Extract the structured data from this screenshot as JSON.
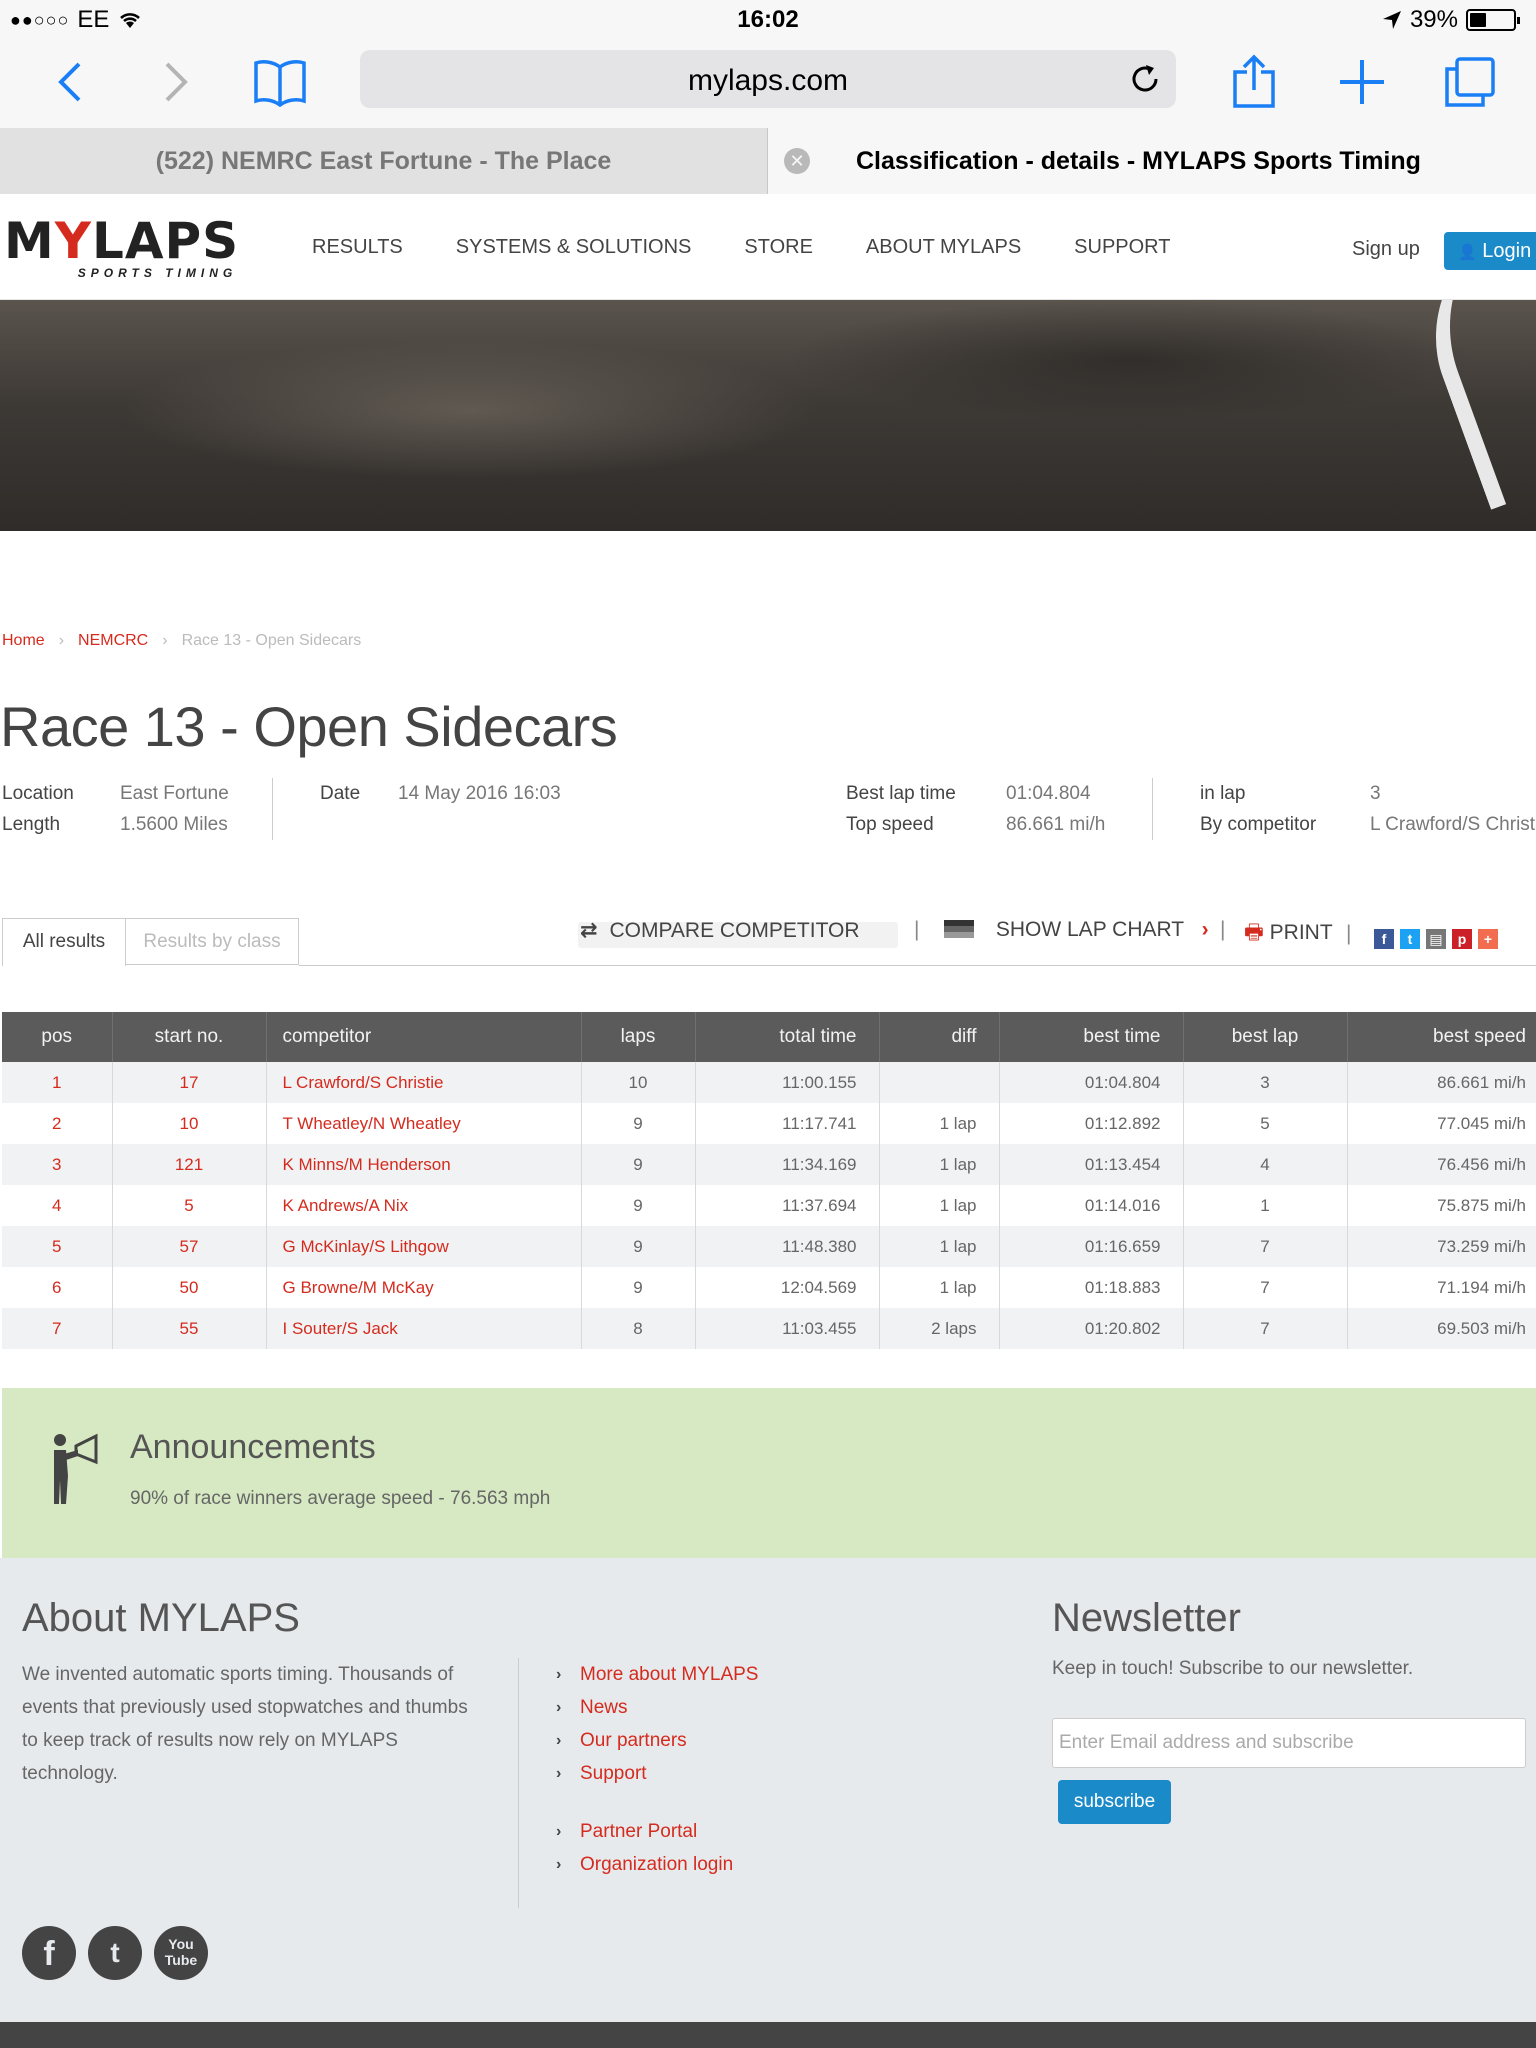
{
  "status_bar": {
    "carrier": "EE",
    "time": "16:02",
    "battery": "39%",
    "battery_level": 0.39
  },
  "browser": {
    "url": "mylaps.com",
    "tabs": [
      {
        "title": "(522) NEMRC East Fortune - The Place"
      },
      {
        "title": "Classification - details - MYLAPS Sports Timing"
      }
    ]
  },
  "header": {
    "logo_word_a": "M",
    "logo_word_b": "Y",
    "logo_word_c": "LAPS",
    "logo_sub": "SPORTS TIMING",
    "nav": [
      "RESULTS",
      "SYSTEMS & SOLUTIONS",
      "STORE",
      "ABOUT MYLAPS",
      "SUPPORT"
    ],
    "signup": "Sign up",
    "login": "Login"
  },
  "breadcrumb": {
    "home": "Home",
    "org": "NEMCRC",
    "current": "Race 13 - Open Sidecars"
  },
  "race": {
    "title": "Race 13 - Open Sidecars",
    "location_label": "Location",
    "location": "East Fortune",
    "length_label": "Length",
    "length": "1.5600 Miles",
    "date_label": "Date",
    "date": "14 May 2016 16:03",
    "best_lap_label": "Best lap time",
    "best_lap": "01:04.804",
    "top_speed_label": "Top speed",
    "top_speed": "86.661 mi/h",
    "in_lap_label": "in lap",
    "in_lap": "3",
    "by_label": "By competitor",
    "by": "L Crawford/S Christi"
  },
  "result_tabs": {
    "all": "All results",
    "by_class": "Results by class"
  },
  "actions": {
    "compare": "COMPARE COMPETITOR",
    "lap_chart": "SHOW LAP CHART",
    "print": "PRINT"
  },
  "table": {
    "headers": [
      "pos",
      "start no.",
      "competitor",
      "laps",
      "total time",
      "diff",
      "best time",
      "best lap",
      "best speed"
    ],
    "rows": [
      [
        "1",
        "17",
        "L Crawford/S Christie",
        "10",
        "11:00.155",
        "",
        "01:04.804",
        "3",
        "86.661 mi/h"
      ],
      [
        "2",
        "10",
        "T Wheatley/N Wheatley",
        "9",
        "11:17.741",
        "1 lap",
        "01:12.892",
        "5",
        "77.045 mi/h"
      ],
      [
        "3",
        "121",
        "K Minns/M Henderson",
        "9",
        "11:34.169",
        "1 lap",
        "01:13.454",
        "4",
        "76.456 mi/h"
      ],
      [
        "4",
        "5",
        "K Andrews/A Nix",
        "9",
        "11:37.694",
        "1 lap",
        "01:14.016",
        "1",
        "75.875 mi/h"
      ],
      [
        "5",
        "57",
        "G McKinlay/S Lithgow",
        "9",
        "11:48.380",
        "1 lap",
        "01:16.659",
        "7",
        "73.259 mi/h"
      ],
      [
        "6",
        "50",
        "G Browne/M McKay",
        "9",
        "12:04.569",
        "1 lap",
        "01:18.883",
        "7",
        "71.194 mi/h"
      ],
      [
        "7",
        "55",
        "I Souter/S Jack",
        "8",
        "11:03.455",
        "2 laps",
        "01:20.802",
        "7",
        "69.503 mi/h"
      ]
    ]
  },
  "announcements": {
    "title": "Announcements",
    "text": "90% of race winners average speed - 76.563 mph"
  },
  "footer": {
    "about_title": "About MYLAPS",
    "about_text": "We invented automatic sports timing. Thousands of events that previously used stopwatches and thumbs to keep track of results now rely on MYLAPS technology.",
    "links": [
      "More about MYLAPS",
      "News",
      "Our partners",
      "Support"
    ],
    "links2": [
      "Partner Portal",
      "Organization login"
    ],
    "newsletter_title": "Newsletter",
    "newsletter_text": "Keep in touch! Subscribe to our newsletter.",
    "email_placeholder": "Enter Email address and subscribe",
    "subscribe": "subscribe",
    "social": [
      "f",
      "t",
      "You Tube"
    ]
  },
  "colors": {
    "brand_red": "#d52b1e",
    "brand_blue": "#1a8ac8",
    "announce_bg": "#d6e9c2",
    "ios_blue": "#1a7ef5"
  }
}
